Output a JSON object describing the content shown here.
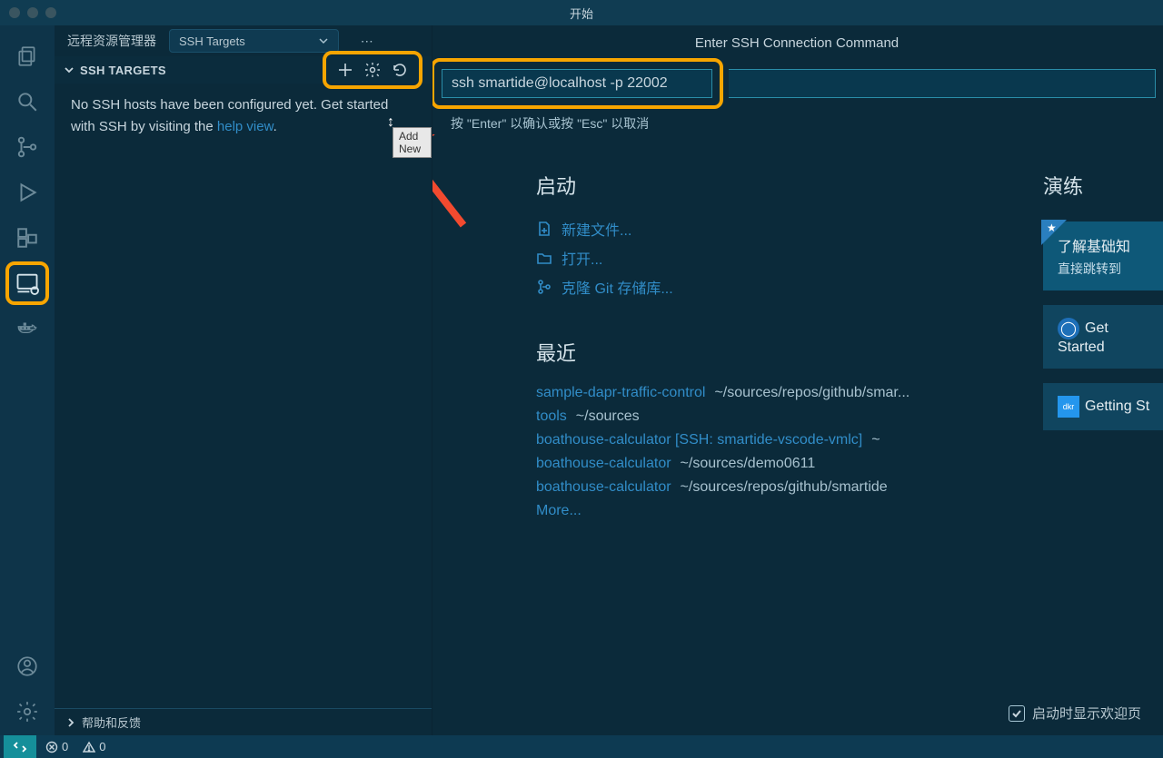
{
  "titlebar": {
    "title": "开始"
  },
  "sidebar": {
    "title": "远程资源管理器",
    "dropdown": {
      "selected": "SSH Targets"
    },
    "section_label": "SSH TARGETS",
    "body_prefix": "No SSH hosts have been configured yet. Get started with SSH by visiting the ",
    "body_link": "help view",
    "body_suffix": ".",
    "tooltip": "Add New",
    "footer_label": "帮助和反馈"
  },
  "palette": {
    "title": "Enter SSH Connection Command",
    "value": "ssh smartide@localhost -p 22002",
    "hint": "按 \"Enter\" 以确认或按 \"Esc\" 以取消"
  },
  "welcome": {
    "start_heading": "启动",
    "start_items": [
      {
        "icon": "new-file",
        "label": "新建文件..."
      },
      {
        "icon": "folder",
        "label": "打开..."
      },
      {
        "icon": "git",
        "label": "克隆 Git 存储库..."
      }
    ],
    "recent_heading": "最近",
    "recent_items": [
      {
        "name": "sample-dapr-traffic-control",
        "path": "~/sources/repos/github/smar..."
      },
      {
        "name": "tools",
        "path": "~/sources"
      },
      {
        "name": "boathouse-calculator [SSH: smartide-vscode-vmlc]",
        "path": "~"
      },
      {
        "name": "boathouse-calculator",
        "path": "~/sources/demo0611"
      },
      {
        "name": "boathouse-calculator",
        "path": "~/sources/repos/github/smartide"
      }
    ],
    "more": "More...",
    "tutorials_heading": "演练",
    "tutorials": [
      {
        "title": "了解基础知",
        "sub": "直接跳转到",
        "featured": true
      },
      {
        "title": "Get Started",
        "badge": "linux"
      },
      {
        "title": "Getting St",
        "badge": "docker"
      }
    ],
    "show_welcome_label": "启动时显示欢迎页"
  },
  "statusbar": {
    "errors": "0",
    "warnings": "0"
  }
}
